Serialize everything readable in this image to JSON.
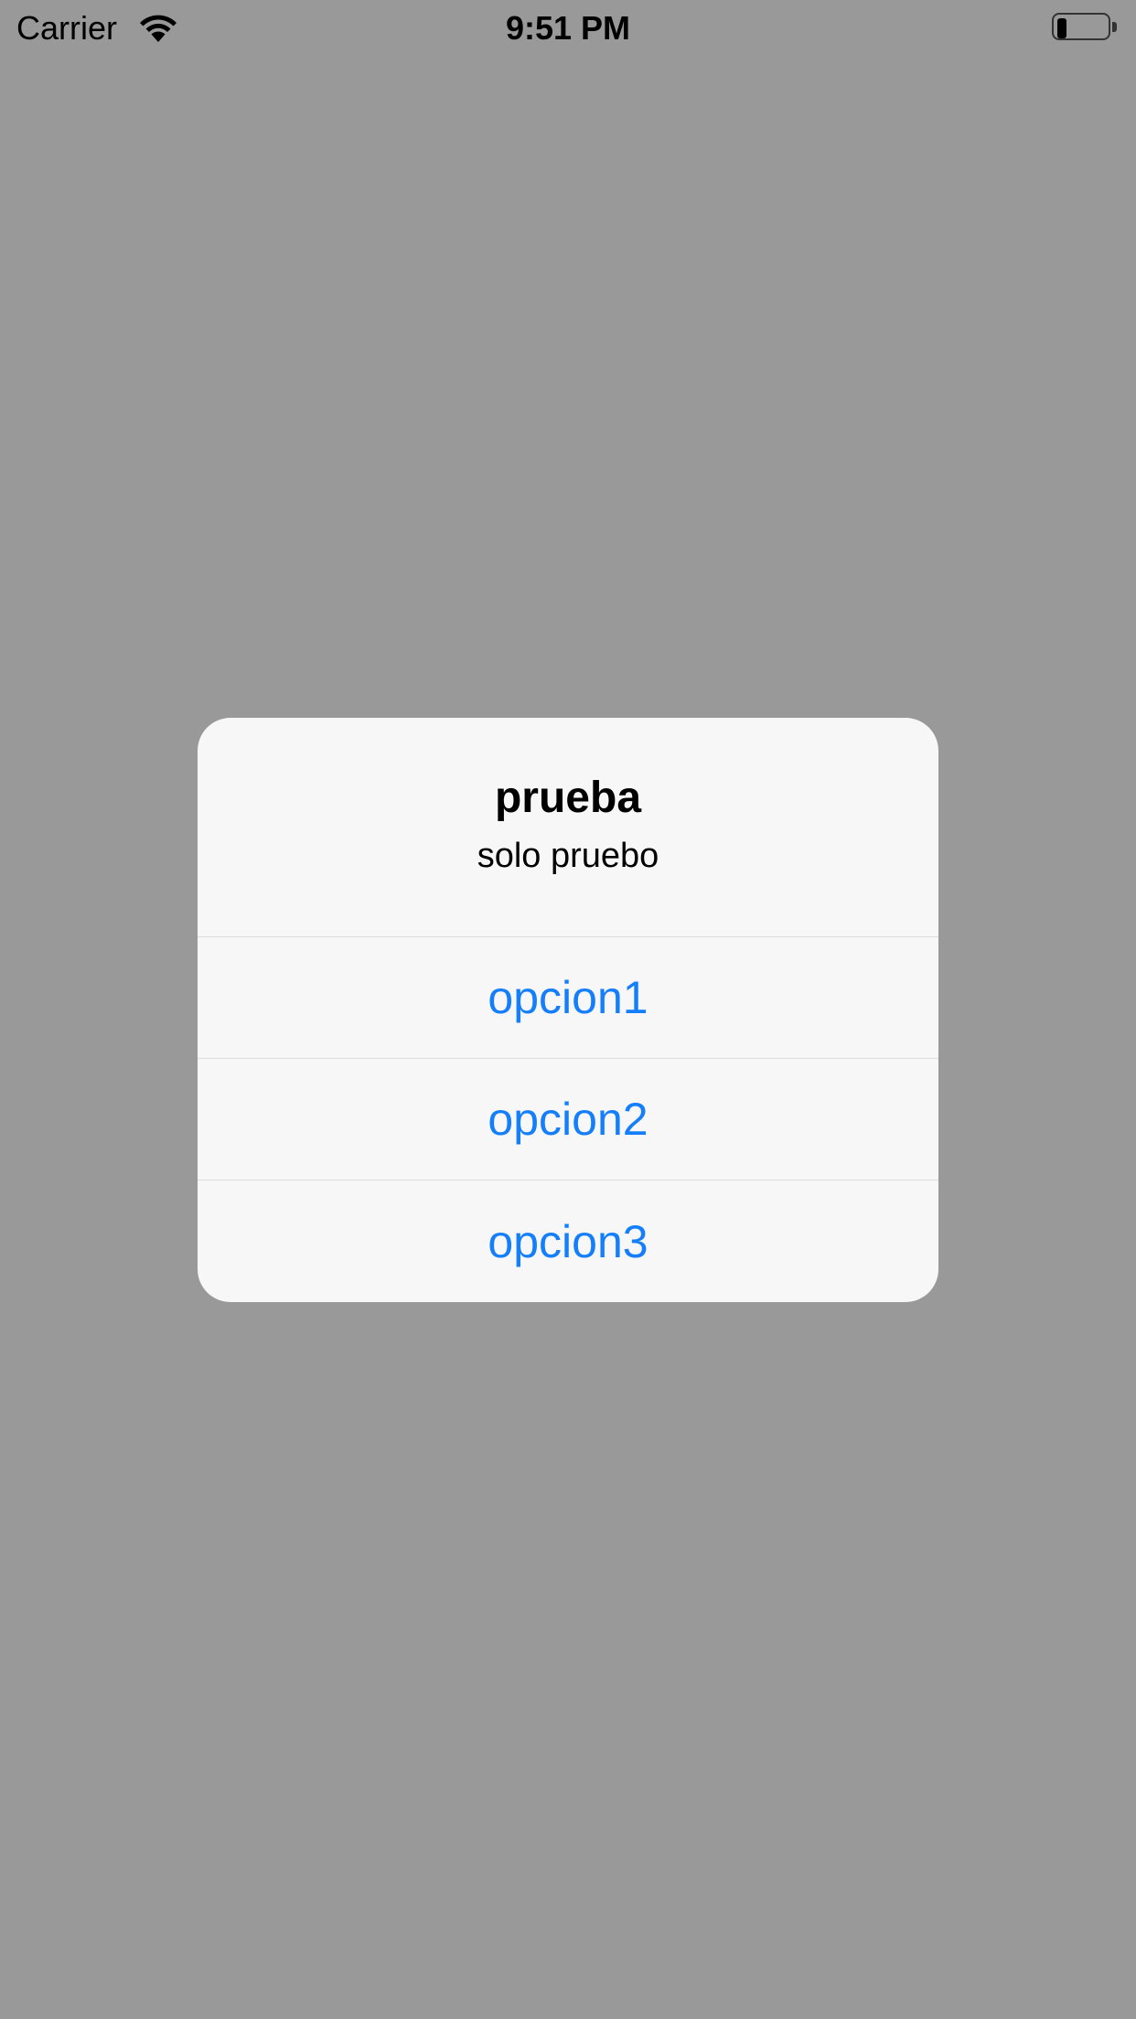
{
  "status_bar": {
    "carrier": "Carrier",
    "time": "9:51 PM",
    "battery_level": 0.2,
    "icons": [
      "wifi-icon",
      "battery-icon"
    ]
  },
  "alert": {
    "title": "prueba",
    "message": "solo pruebo",
    "actions": [
      {
        "label": "opcion1"
      },
      {
        "label": "opcion2"
      },
      {
        "label": "opcion3"
      }
    ]
  },
  "colors": {
    "background": "#999999",
    "alert_background": "#f7f7f7",
    "action_tint": "#147efb",
    "separator": "#dcdcdc"
  }
}
